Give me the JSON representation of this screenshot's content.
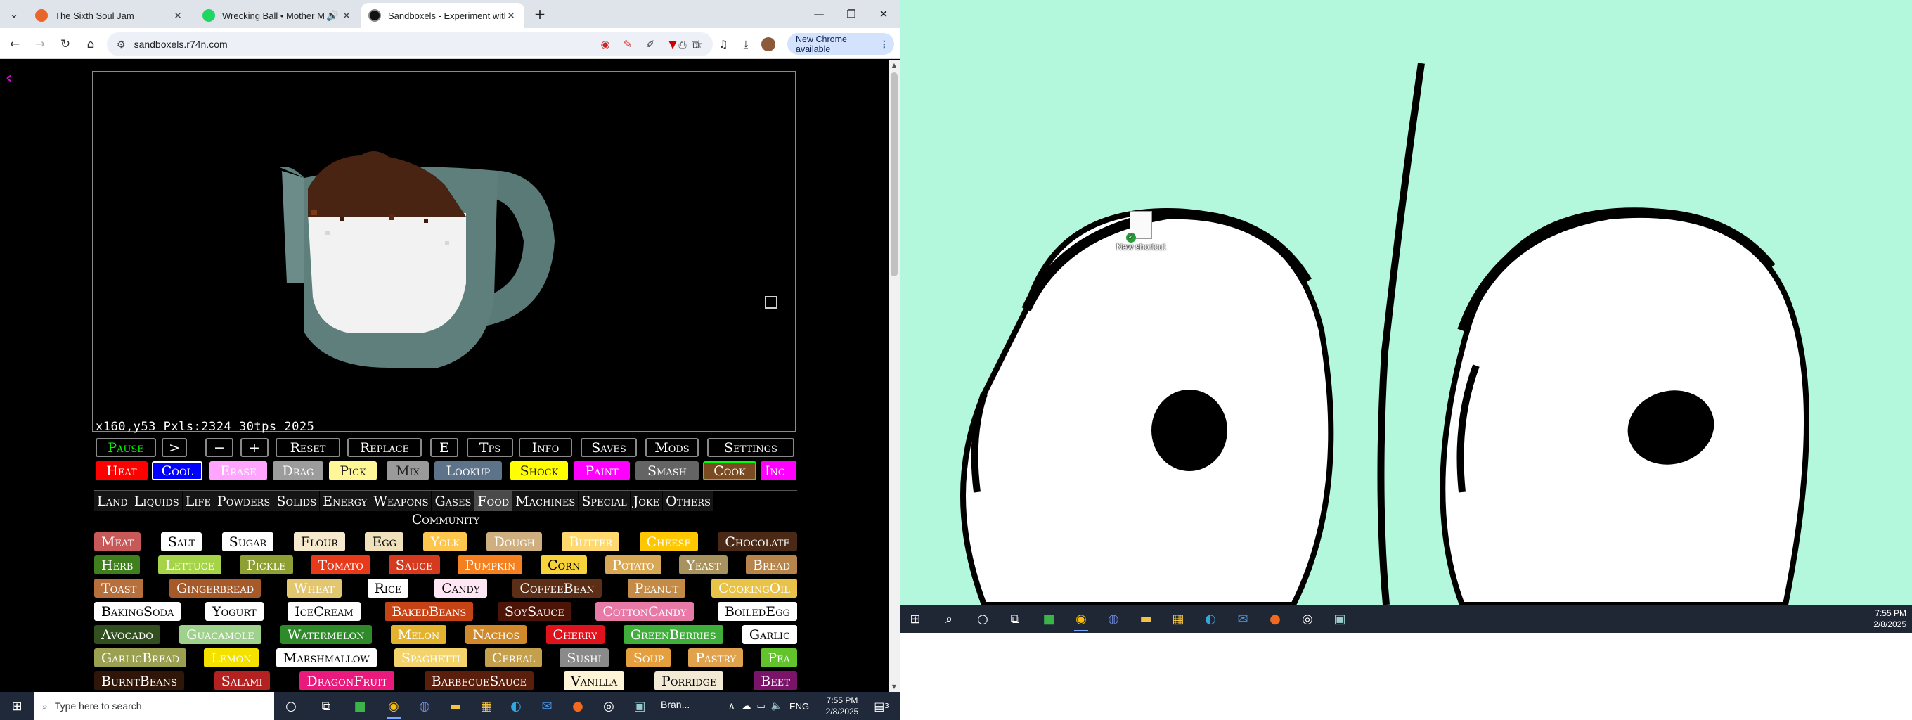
{
  "browser": {
    "tabs": [
      {
        "title": "The Sixth Soul Jam",
        "favicon_color": "#e8652b",
        "active": false,
        "audio": false
      },
      {
        "title": "Wrecking Ball • Mother Mo",
        "favicon_color": "#1ed760",
        "active": false,
        "audio": true
      },
      {
        "title": "Sandboxels - Experiment with P",
        "favicon_color": "#111111",
        "active": true,
        "audio": false
      }
    ],
    "new_tab_label": "+",
    "url": "sandboxels.r74n.com",
    "update_button": "New Chrome available",
    "window_controls": {
      "minimize": "—",
      "restore": "❐",
      "close": "✕"
    }
  },
  "game": {
    "stats": "x160,y53   Pxls:2324   30tps   2025",
    "controls": [
      "Pause",
      ">",
      "−",
      "+",
      "Reset",
      "Replace",
      "E",
      "Tps",
      "Info",
      "Saves",
      "Mods",
      "Settings"
    ],
    "tools": [
      {
        "label": "Heat",
        "bg": "#ff0000",
        "fg": "#ffffff"
      },
      {
        "label": "Cool",
        "bg": "#0000ff",
        "fg": "#ffffff"
      },
      {
        "label": "Erase",
        "bg": "#ffa5ff",
        "fg": "#ffffff"
      },
      {
        "label": "Drag",
        "bg": "#9c9c9c",
        "fg": "#ffffff"
      },
      {
        "label": "Pick",
        "bg": "#fff697",
        "fg": "#222222"
      },
      {
        "label": "Mix",
        "bg": "#9a9a9a",
        "fg": "#222222"
      },
      {
        "label": "Lookup",
        "bg": "#5c7389",
        "fg": "#ffffff"
      },
      {
        "label": "Shock",
        "bg": "#ffff00",
        "fg": "#222222"
      },
      {
        "label": "Paint",
        "bg": "#ff00ff",
        "fg": "#ffffff"
      },
      {
        "label": "Smash",
        "bg": "#646464",
        "fg": "#ffffff"
      },
      {
        "label": "Cook",
        "bg": "#7a4b21",
        "fg": "#ffffff"
      },
      {
        "label": "Inc",
        "bg": "#ff00ff",
        "fg": "#ffffff"
      }
    ],
    "categories": [
      "Land",
      "Liquids",
      "Life",
      "Powders",
      "Solids",
      "Energy",
      "Weapons",
      "Gases",
      "Food",
      "Machines",
      "Special",
      "Joke",
      "Others"
    ],
    "selected_category": "Food",
    "community_label": "Community",
    "elements": [
      [
        {
          "l": "Meat",
          "bg": "#c75958",
          "fg": "#ffffff"
        },
        {
          "l": "Salt",
          "bg": "#ffffff",
          "fg": "#000000"
        },
        {
          "l": "Sugar",
          "bg": "#ffffff",
          "fg": "#000000"
        },
        {
          "l": "Flour",
          "bg": "#f7e9cd",
          "fg": "#000000"
        },
        {
          "l": "Egg",
          "bg": "#f0e1bd",
          "fg": "#000000"
        },
        {
          "l": "Yolk",
          "bg": "#ffc64d",
          "fg": "#ffffff"
        },
        {
          "l": "Dough",
          "bg": "#cfae7f",
          "fg": "#ffffff"
        },
        {
          "l": "Butter",
          "bg": "#ffd96e",
          "fg": "#ffffff"
        },
        {
          "l": "Cheese",
          "bg": "#ffc700",
          "fg": "#ffffff"
        },
        {
          "l": "Chocolate",
          "bg": "#4a2a17",
          "fg": "#ffffff"
        }
      ],
      [
        {
          "l": "Herb",
          "bg": "#3f7f1e",
          "fg": "#ffffff"
        },
        {
          "l": "Lettuce",
          "bg": "#a5d448",
          "fg": "#ffffff"
        },
        {
          "l": "Pickle",
          "bg": "#8ea033",
          "fg": "#ffffff"
        },
        {
          "l": "Tomato",
          "bg": "#e63a1a",
          "fg": "#ffffff"
        },
        {
          "l": "Sauce",
          "bg": "#d63a1e",
          "fg": "#ffffff"
        },
        {
          "l": "Pumpkin",
          "bg": "#f5801f",
          "fg": "#ffffff"
        },
        {
          "l": "Corn",
          "bg": "#f7d23a",
          "fg": "#000000"
        },
        {
          "l": "Potato",
          "bg": "#d9a855",
          "fg": "#ffffff"
        },
        {
          "l": "Yeast",
          "bg": "#a8925e",
          "fg": "#ffffff"
        },
        {
          "l": "Bread",
          "bg": "#b7854c",
          "fg": "#ffffff"
        }
      ],
      [
        {
          "l": "Toast",
          "bg": "#b7703c",
          "fg": "#ffffff"
        },
        {
          "l": "Gingerbread",
          "bg": "#a65a2a",
          "fg": "#ffffff"
        },
        {
          "l": "Wheat",
          "bg": "#e3c770",
          "fg": "#ffffff"
        },
        {
          "l": "Rice",
          "bg": "#ffffff",
          "fg": "#000000"
        },
        {
          "l": "Candy",
          "bg": "#ffe6f4",
          "fg": "#000000"
        },
        {
          "l": "CoffeeBean",
          "bg": "#5d2e16",
          "fg": "#ffffff"
        },
        {
          "l": "Peanut",
          "bg": "#c48b47",
          "fg": "#ffffff"
        },
        {
          "l": "CookingOil",
          "bg": "#e9c248",
          "fg": "#ffffff"
        }
      ],
      [
        {
          "l": "BakingSoda",
          "bg": "#ffffff",
          "fg": "#000000"
        },
        {
          "l": "Yogurt",
          "bg": "#ffffff",
          "fg": "#000000"
        },
        {
          "l": "IceCream",
          "bg": "#ffffff",
          "fg": "#000000"
        },
        {
          "l": "BakedBeans",
          "bg": "#c54315",
          "fg": "#ffffff"
        },
        {
          "l": "SoySauce",
          "bg": "#4d1408",
          "fg": "#ffffff"
        },
        {
          "l": "CottonCandy",
          "bg": "#e87aa7",
          "fg": "#ffffff"
        },
        {
          "l": "BoiledEgg",
          "bg": "#ffffff",
          "fg": "#000000"
        }
      ],
      [
        {
          "l": "Avocado",
          "bg": "#314f1f",
          "fg": "#ffffff"
        },
        {
          "l": "Guacamole",
          "bg": "#9ed18b",
          "fg": "#ffffff"
        },
        {
          "l": "Watermelon",
          "bg": "#2f8a2a",
          "fg": "#ffffff"
        },
        {
          "l": "Melon",
          "bg": "#e3b32d",
          "fg": "#ffffff"
        },
        {
          "l": "Nachos",
          "bg": "#d08a2b",
          "fg": "#ffffff"
        },
        {
          "l": "Cherry",
          "bg": "#e0121c",
          "fg": "#ffffff"
        },
        {
          "l": "GreenBerries",
          "bg": "#3fae3a",
          "fg": "#ffffff"
        },
        {
          "l": "Garlic",
          "bg": "#ffffff",
          "fg": "#000000"
        }
      ],
      [
        {
          "l": "GarlicBread",
          "bg": "#9aa050",
          "fg": "#ffffff"
        },
        {
          "l": "Lemon",
          "bg": "#f5e100",
          "fg": "#ffffff"
        },
        {
          "l": "Marshmallow",
          "bg": "#ffffff",
          "fg": "#000000"
        },
        {
          "l": "Spaghetti",
          "bg": "#f3d36c",
          "fg": "#ffffff"
        },
        {
          "l": "Cereal",
          "bg": "#c4a04c",
          "fg": "#ffffff"
        },
        {
          "l": "Sushi",
          "bg": "#8a8a8a",
          "fg": "#ffffff"
        },
        {
          "l": "Soup",
          "bg": "#e4a03e",
          "fg": "#ffffff"
        },
        {
          "l": "Pastry",
          "bg": "#e1a24e",
          "fg": "#ffffff"
        },
        {
          "l": "Pea",
          "bg": "#62c32b",
          "fg": "#ffffff"
        }
      ],
      [
        {
          "l": "BurntBeans",
          "bg": "#2f1608",
          "fg": "#ffffff"
        },
        {
          "l": "Salami",
          "bg": "#b32120",
          "fg": "#ffffff"
        },
        {
          "l": "DragonFruit",
          "bg": "#ea1a7d",
          "fg": "#ffffff"
        },
        {
          "l": "BarbecueSauce",
          "bg": "#5a1e0c",
          "fg": "#ffffff"
        },
        {
          "l": "Vanilla",
          "bg": "#fff3d8",
          "fg": "#000000"
        },
        {
          "l": "Porridge",
          "bg": "#f2ead4",
          "fg": "#000000"
        },
        {
          "l": "Beet",
          "bg": "#7a1469",
          "fg": "#ffffff"
        }
      ]
    ]
  },
  "taskbar_left": {
    "search_placeholder": "Type here to search",
    "app_label": "Bran...",
    "language": "ENG",
    "time": "7:55 PM",
    "date": "2/8/2025",
    "notification_count": "3"
  },
  "desktop_right": {
    "shortcut_label": "New shortcut",
    "time": "7:55 PM",
    "date": "2/8/2025"
  }
}
